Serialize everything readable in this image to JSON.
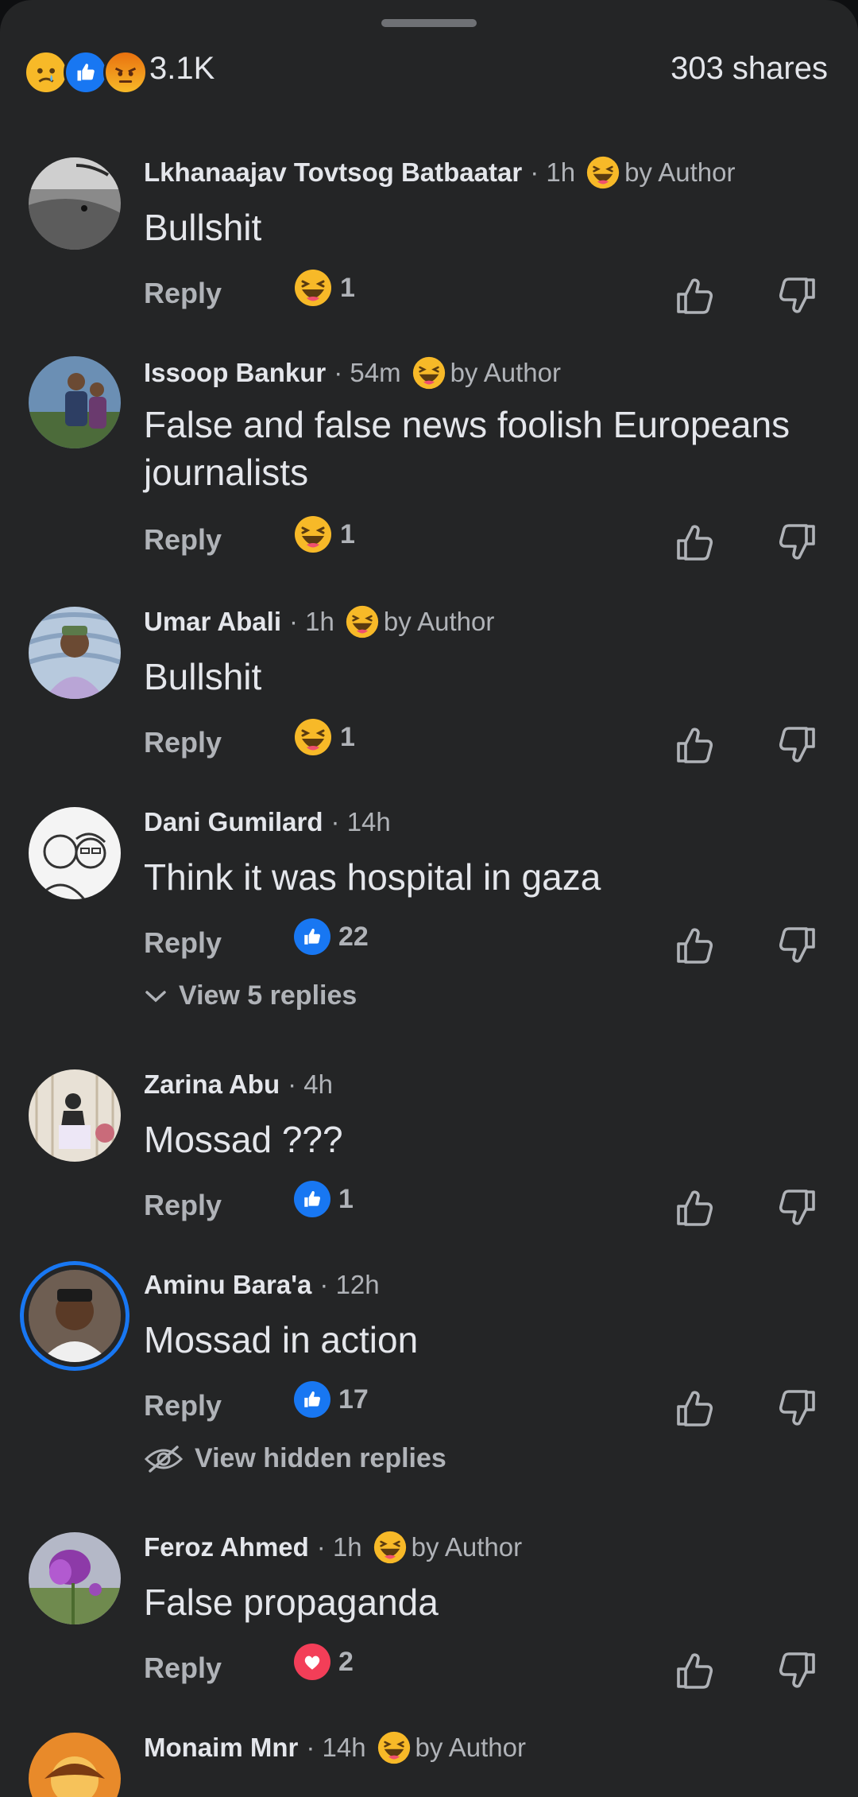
{
  "summary": {
    "reaction_count": "3.1K",
    "shares": "303 shares",
    "reactions": [
      "sad-icon",
      "like-icon",
      "angry-icon"
    ]
  },
  "comments": [
    {
      "name": "Lkhanaajav Tovtsog Batbaatar",
      "time": "· 1h",
      "by_author": "by Author",
      "text": "Bullshit",
      "reply": "Reply",
      "reaction": "haha",
      "count": "1"
    },
    {
      "name": "Issoop Bankur",
      "time": "· 54m",
      "by_author": "by Author",
      "text": "False and false news foolish Europeans journalists",
      "reply": "Reply",
      "reaction": "haha",
      "count": "1"
    },
    {
      "name": "Umar Abali",
      "time": "· 1h",
      "by_author": "by Author",
      "text": "Bullshit",
      "reply": "Reply",
      "reaction": "haha",
      "count": "1"
    },
    {
      "name": "Dani Gumilard",
      "time": "· 14h",
      "text": "Think it was hospital in gaza",
      "reply": "Reply",
      "reaction": "like",
      "count": "22",
      "view_more": "View 5 replies"
    },
    {
      "name": "Zarina Abu",
      "time": "· 4h",
      "text": "Mossad ???",
      "reply": "Reply",
      "reaction": "like",
      "count": "1"
    },
    {
      "name": "Aminu Bara'a",
      "time": "· 12h",
      "text": "Mossad in action",
      "reply": "Reply",
      "reaction": "like",
      "count": "17",
      "view_more": "View hidden replies"
    },
    {
      "name": "Feroz Ahmed",
      "time": "· 1h",
      "by_author": "by Author",
      "text": "False propaganda",
      "reply": "Reply",
      "reaction": "love",
      "count": "2"
    },
    {
      "name": "Monaim Mnr",
      "time": "· 14h",
      "by_author": "by Author"
    }
  ],
  "colors": {
    "background": "#242526",
    "accent": "#1877f2",
    "love": "#f33e58",
    "haha": "#f7b928"
  }
}
